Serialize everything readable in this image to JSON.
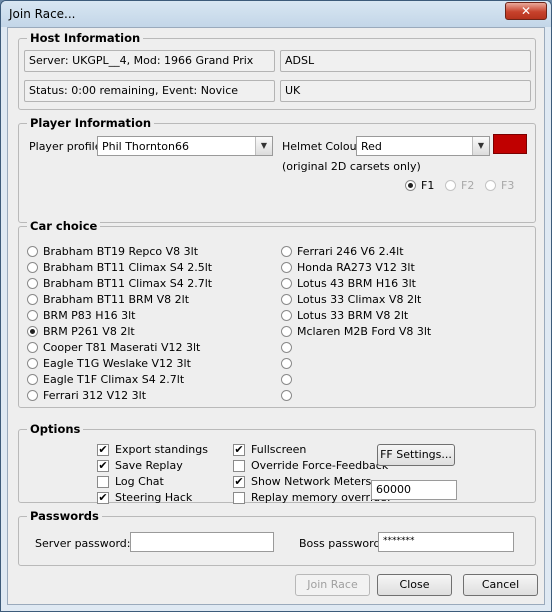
{
  "window": {
    "title": "Join Race...",
    "close_glyph": "✕"
  },
  "host": {
    "group_title": "Host Information",
    "server": "Server: UKGPL__4,  Mod: 1966 Grand Prix",
    "connection": "ADSL",
    "status": "Status:  0:00 remaining,  Event: Novice",
    "country": "UK"
  },
  "player": {
    "group_title": "Player Information",
    "profile_label": "Player profile:",
    "profile_value": "Phil Thornton66",
    "helmet_label": "Helmet Colour:",
    "helmet_value": "Red",
    "helmet_color": "#c00000",
    "carset_note": "(original 2D carsets only)",
    "carsets": [
      {
        "label": "F1",
        "selected": true,
        "enabled": true
      },
      {
        "label": "F2",
        "selected": false,
        "enabled": false
      },
      {
        "label": "F3",
        "selected": false,
        "enabled": false
      }
    ]
  },
  "cars": {
    "group_title": "Car choice",
    "left": [
      "Brabham BT19 Repco V8 3lt",
      "Brabham BT11 Climax S4 2.5lt",
      "Brabham BT11 Climax S4 2.7lt",
      "Brabham BT11 BRM V8 2lt",
      "BRM P83 H16 3lt",
      "BRM P261 V8 2lt",
      "Cooper T81 Maserati V12 3lt",
      "Eagle T1G Weslake V12 3lt",
      "Eagle T1F Climax S4 2.7lt",
      "Ferrari 312 V12 3lt"
    ],
    "right": [
      "Ferrari 246 V6 2.4lt",
      "Honda RA273 V12 3lt",
      "Lotus 43 BRM H16 3lt",
      "Lotus 33 Climax V8 2lt",
      "Lotus 33 BRM V8 2lt",
      "Mclaren M2B Ford V8 3lt",
      "",
      "",
      "",
      ""
    ],
    "selected": "BRM P261 V8 2lt"
  },
  "options": {
    "group_title": "Options",
    "left": [
      {
        "label": "Export standings",
        "checked": true
      },
      {
        "label": "Save Replay",
        "checked": true
      },
      {
        "label": "Log Chat",
        "checked": false
      },
      {
        "label": "Steering Hack",
        "checked": true
      }
    ],
    "right": [
      {
        "label": "Fullscreen",
        "checked": true
      },
      {
        "label": "Override Force-Feedback",
        "checked": false
      },
      {
        "label": "Show Network Meters",
        "checked": true
      },
      {
        "label": "Replay memory override:",
        "checked": false
      }
    ],
    "ff_settings_label": "FF Settings...",
    "replay_memory_value": "60000",
    "check_glyph": "✔"
  },
  "passwords": {
    "group_title": "Passwords",
    "server_label": "Server password:",
    "server_value": "",
    "boss_label": "Boss password:",
    "boss_value": "*******"
  },
  "buttons": {
    "join": "Join Race",
    "close": "Close",
    "cancel": "Cancel"
  }
}
